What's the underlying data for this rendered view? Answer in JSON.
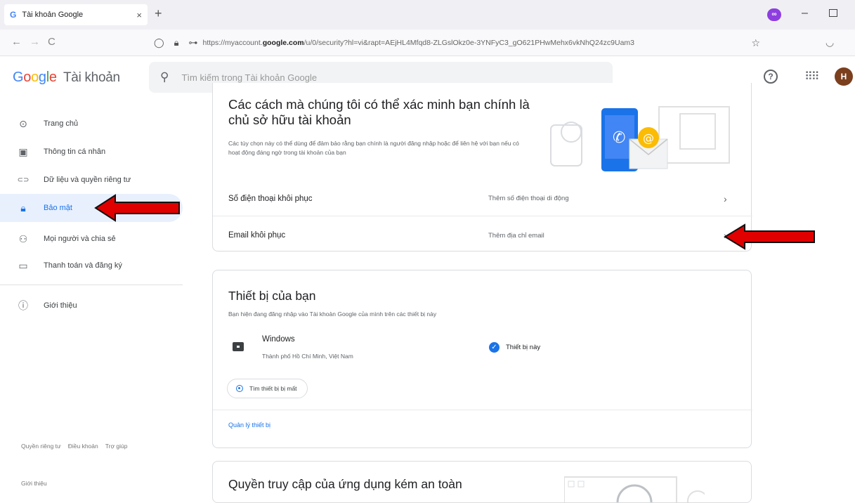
{
  "browser": {
    "tab": {
      "favicon": "G",
      "title": "Tài khoản Google",
      "close": "×"
    },
    "new_tab": "+",
    "extension_badge": "∞",
    "window_min": "–",
    "nav": {
      "back": "←",
      "forward": "→",
      "reload": "C"
    },
    "url": {
      "prefix": "https://myaccount.",
      "domain": "google.com",
      "suffix": "/u/0/security?hl=vi&rapt=AEjHL4Mfqd8-ZLGslOkz0e-3YNFyC3_gO621PHwMehx6vkNhQ24zc9Uam3",
      "bookmark_icon": "star-icon"
    }
  },
  "header": {
    "logo_letters": [
      "G",
      "o",
      "o",
      "g",
      "l",
      "e"
    ],
    "product": "Tài khoản",
    "search_placeholder": "Tìm kiếm trong Tài khoản Google",
    "avatar_letter": "H"
  },
  "sidebar": {
    "items": [
      {
        "label": "Trang chủ",
        "icon": "home-icon",
        "glyph": "⊙"
      },
      {
        "label": "Thông tin cá nhân",
        "icon": "id-card-icon",
        "glyph": "▣"
      },
      {
        "label": "Dữ liệu và quyền riêng tư",
        "icon": "toggle-icon",
        "glyph": "⊂⊃"
      },
      {
        "label": "Bảo mật",
        "icon": "lock-icon",
        "glyph": "🔒︎"
      },
      {
        "label": "Mọi người và chia sẻ",
        "icon": "people-icon",
        "glyph": "⚇"
      },
      {
        "label": "Thanh toán và đăng ký",
        "icon": "card-icon",
        "glyph": "▭"
      },
      {
        "label": "Giới thiệu",
        "icon": "info-icon",
        "glyph": "ⓘ"
      }
    ],
    "footer": {
      "privacy": "Quyền riêng tư",
      "terms": "Điều khoản",
      "help": "Trợ giúp",
      "about": "Giới thiệu"
    }
  },
  "recovery_card": {
    "title": "Các cách mà chúng tôi có thể xác minh bạn chính là chủ sở hữu tài khoản",
    "description": "Các tùy chọn này có thể dùng để đảm bảo rằng bạn chính là người đăng nhập hoặc để liên hệ với bạn nếu có hoạt động đáng ngờ trong tài khoản của bạn",
    "rows": [
      {
        "label": "Số điện thoại khôi phục",
        "value": "Thêm số điện thoại di động",
        "chevron": "›"
      },
      {
        "label": "Email khôi phục",
        "value": "Thêm địa chỉ email",
        "chevron": "›"
      }
    ]
  },
  "devices_card": {
    "title": "Thiết bị của bạn",
    "description": "Bạn hiện đang đăng nhập vào Tài khoản Google của mình trên các thiết bị này",
    "device": {
      "name": "Windows",
      "location": "Thành phố Hồ Chí Minh, Việt Nam",
      "this_device": "Thiết bị này"
    },
    "find_device": "Tìm thiết bị bị mất",
    "manage_devices": "Quản lý thiết bị"
  },
  "less_secure_card": {
    "title": "Quyền truy cập của ứng dụng kém an toàn"
  },
  "colors": {
    "brand_blue": "#1a73e8",
    "annotation_red": "#e00000",
    "active_bg": "#e8f0fe"
  }
}
